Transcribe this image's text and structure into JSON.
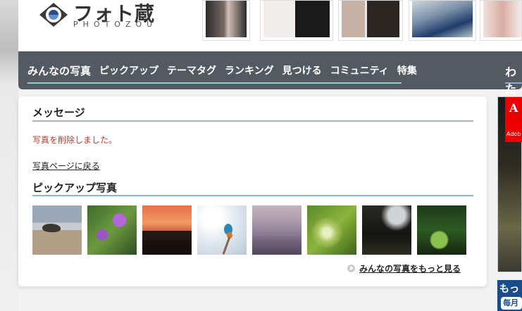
{
  "header": {
    "logo_text": "フォト蔵",
    "logo_sub": "PHOTOZOU"
  },
  "nav": {
    "items": [
      {
        "label": "みんなの写真"
      },
      {
        "label": "ピックアップ"
      },
      {
        "label": "テーマタグ"
      },
      {
        "label": "ランキング"
      },
      {
        "label": "見つける"
      },
      {
        "label": "コミュニティ"
      },
      {
        "label": "特集"
      }
    ],
    "right_label": "わた"
  },
  "message": {
    "title": "メッセージ",
    "text": "写真を削除しました。",
    "back_link": "写真ページに戻る"
  },
  "pickup": {
    "title": "ピックアップ写真",
    "more_link": "みんなの写真をもっと見る"
  },
  "ad": {
    "brand_mark": "A",
    "brand_text": "Adob",
    "banner_text": "もっ",
    "badge_text": "毎月"
  },
  "colors": {
    "nav_bg": "#535a61",
    "nav_active_underline": "#7fd3c8",
    "message_text": "#c0392b",
    "section_rule_blue": "#8fb0e6"
  }
}
